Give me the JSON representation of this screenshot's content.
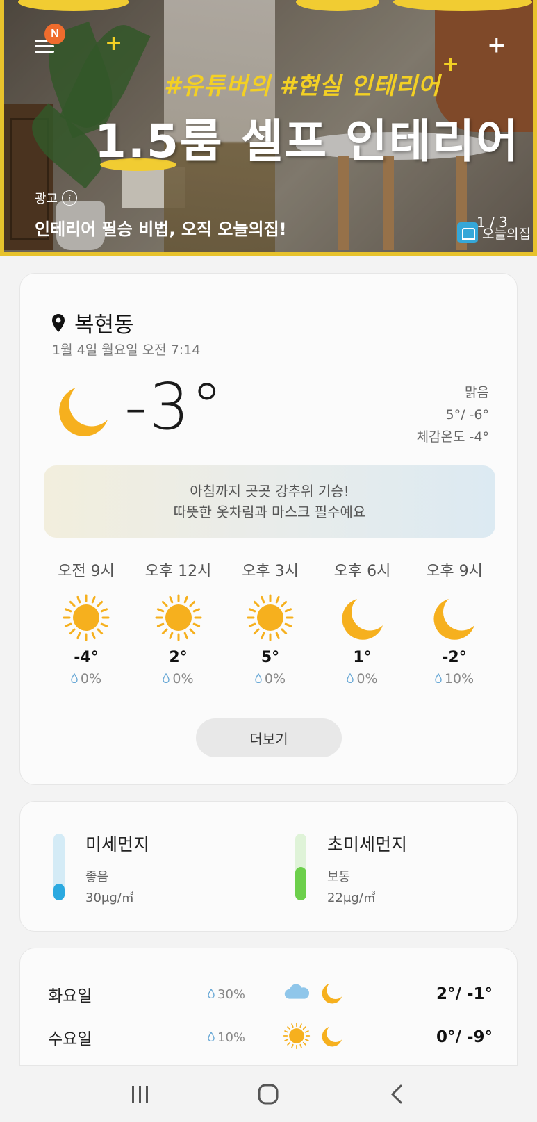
{
  "banner": {
    "subtitle": "#유튜버의 #현실 인테리어",
    "title": "1.5룸 셀프 인테리어",
    "ad_label": "광고",
    "headline": "인테리어 필승 비법, 오직 오늘의집!",
    "counter": "1 / 3",
    "brand_name": "오늘의집",
    "menu_badge": "N",
    "accent": "#e7c22c"
  },
  "weather": {
    "location": "복현동",
    "datetime": "1월 4일 월요일 오전 7:14",
    "current_temp": "-3°",
    "condition": "맑음",
    "high_low": "5°/ -6°",
    "feels_like": "체감온도 -4°",
    "alert_line1": "아침까지 곳곳 강추위 기승!",
    "alert_line2": "따뜻한 옷차림과 마스크 필수예요",
    "hourly": [
      {
        "time": "오전 9시",
        "icon": "sun-icon",
        "temp": "-4°",
        "rain": "0%"
      },
      {
        "time": "오후 12시",
        "icon": "sun-icon",
        "temp": "2°",
        "rain": "0%"
      },
      {
        "time": "오후 3시",
        "icon": "sun-icon",
        "temp": "5°",
        "rain": "0%"
      },
      {
        "time": "오후 6시",
        "icon": "moon-icon",
        "temp": "1°",
        "rain": "0%"
      },
      {
        "time": "오후 9시",
        "icon": "moon-icon",
        "temp": "-2°",
        "rain": "10%"
      }
    ],
    "more_label": "더보기",
    "sun_color": "#f6b01e"
  },
  "dust": {
    "pm10": {
      "name": "미세먼지",
      "grade": "좋음",
      "value": "30μg/㎥",
      "level_fraction": 0.25,
      "color": "#2ba9e0",
      "track": "#d4ebf6"
    },
    "pm25": {
      "name": "초미세먼지",
      "grade": "보통",
      "value": "22μg/㎥",
      "level_fraction": 0.5,
      "color": "#6ccf4b",
      "track": "#dff3d8"
    }
  },
  "weekly": [
    {
      "day": "화요일",
      "rain": "30%",
      "am_icon": "cloud-icon",
      "pm_icon": "moon-icon",
      "temp": "2°/ -1°"
    },
    {
      "day": "수요일",
      "rain": "10%",
      "am_icon": "sun-icon",
      "pm_icon": "moon-icon",
      "temp": "0°/ -9°"
    }
  ],
  "nav": {
    "recents_icon": "recents-icon",
    "home_icon": "home-icon",
    "back_icon": "back-icon"
  }
}
